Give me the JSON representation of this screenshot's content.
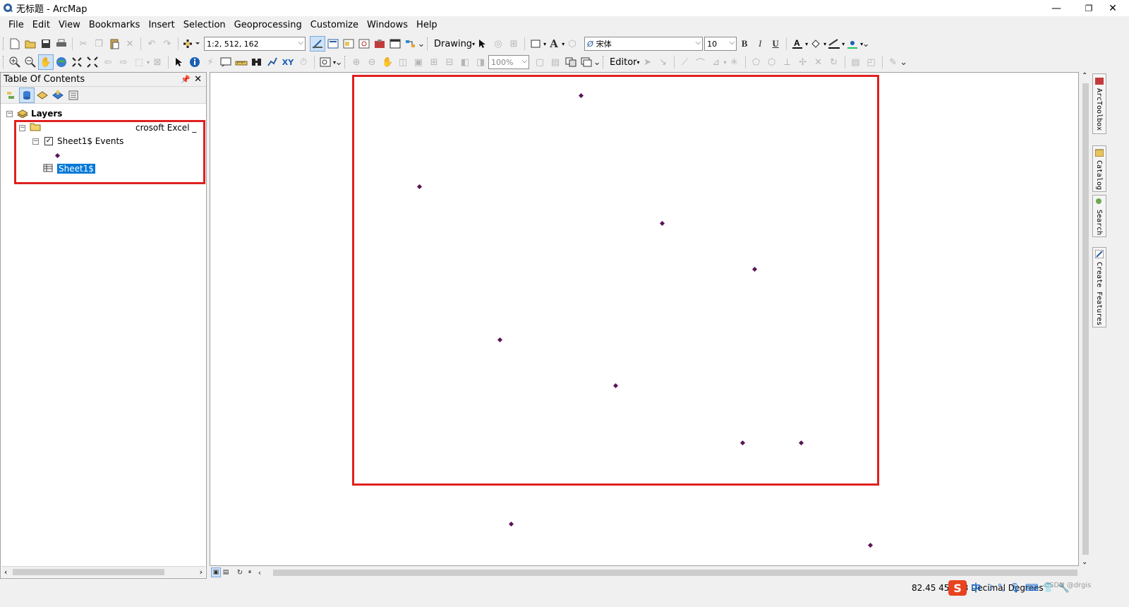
{
  "window": {
    "title": "无标题 - ArcMap",
    "minimize": "—",
    "restore": "❐",
    "close": "✕"
  },
  "menu": [
    "File",
    "Edit",
    "View",
    "Bookmarks",
    "Insert",
    "Selection",
    "Geoprocessing",
    "Customize",
    "Windows",
    "Help"
  ],
  "toolbar": {
    "scale_value": "1:2, 512, 162",
    "drawing_label": "Drawing",
    "font_name": "宋体",
    "font_size": "10",
    "bold": "B",
    "italic": "I",
    "underline": "U",
    "zoom_percent": "100%",
    "editor_label": "Editor"
  },
  "toc": {
    "title": "Table Of Contents",
    "root_label": "Layers",
    "folder_label": "crosoft Excel _",
    "layer_label": "Sheet1$ Events",
    "table_label": "Sheet1$"
  },
  "dock_tabs": [
    "ArcToolbox",
    "Catalog",
    "Search",
    "Create Features"
  ],
  "status": {
    "coordinates": "82.45  45.578 Decimal Degrees",
    "watermark": "CSDN @drgis",
    "ime_logo": "S",
    "ime_lang": "中"
  },
  "colors": {
    "point_fill": "#5a1457",
    "highlight": "#e02020",
    "selection": "#0078d7"
  },
  "icons": {
    "point_symbol": "diamond-marker",
    "layer_table": "table-icon"
  }
}
